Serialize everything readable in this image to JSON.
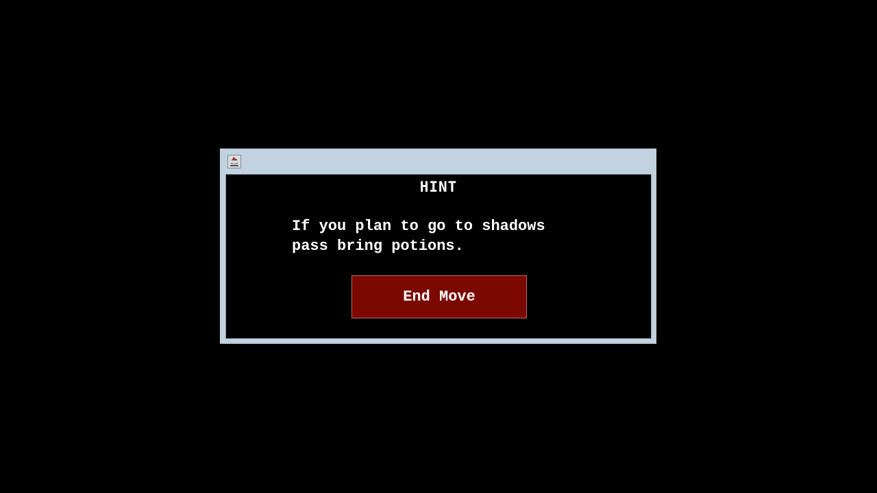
{
  "dialog": {
    "icon": "java-cup-icon",
    "title": "HINT",
    "message": "If you plan to go to shadows\npass bring potions.",
    "button_label": "End Move"
  },
  "colors": {
    "background": "#000000",
    "frame": "#c3d2df",
    "button": "#7b0902",
    "text": "#ffffff"
  }
}
